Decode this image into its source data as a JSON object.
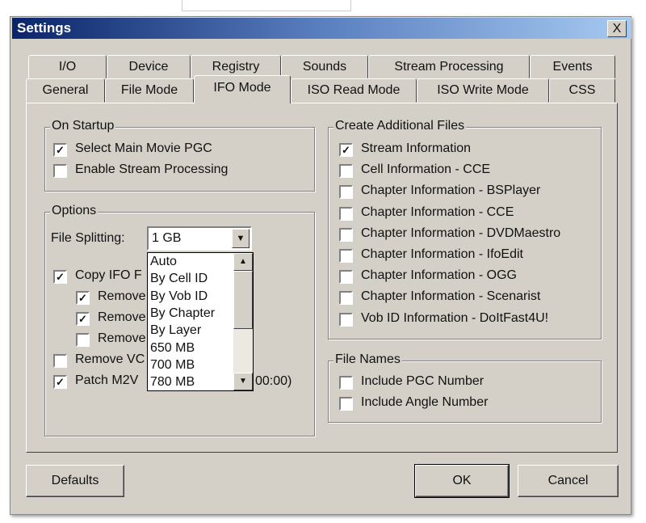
{
  "window": {
    "title": "Settings",
    "close": "X"
  },
  "tabs_row1": [
    "I/O",
    "Device",
    "Registry",
    "Sounds",
    "Stream Processing",
    "Events"
  ],
  "tabs_row2": [
    "General",
    "File Mode",
    "IFO Mode",
    "ISO Read Mode",
    "ISO Write Mode",
    "CSS"
  ],
  "selected_tab": "IFO Mode",
  "on_startup": {
    "legend": "On Startup",
    "items": [
      {
        "label": "Select Main Movie PGC",
        "checked": true
      },
      {
        "label": "Enable Stream Processing",
        "checked": false
      }
    ]
  },
  "options": {
    "legend": "Options",
    "file_splitting_label": "File Splitting:",
    "file_splitting_value": "1 GB",
    "dropdown_options": [
      "Auto",
      "By Cell ID",
      "By Vob ID",
      "By Chapter",
      "By Layer",
      "650 MB",
      "700 MB",
      "780 MB"
    ],
    "items": [
      {
        "label": "Copy IFO F",
        "checked": true
      },
      {
        "label": "Remove",
        "checked": true
      },
      {
        "label": "Remove",
        "checked": true
      },
      {
        "label": "Remove",
        "checked": false
      },
      {
        "label": "Remove VC",
        "checked": false
      },
      {
        "label": "Patch M2V",
        "checked": true
      }
    ],
    "patch_tail": "00:00)"
  },
  "create_files": {
    "legend": "Create Additional Files",
    "items": [
      {
        "label": "Stream Information",
        "checked": true
      },
      {
        "label": "Cell Information - CCE",
        "checked": false
      },
      {
        "label": "Chapter Information - BSPlayer",
        "checked": false
      },
      {
        "label": "Chapter Information - CCE",
        "checked": false
      },
      {
        "label": "Chapter Information - DVDMaestro",
        "checked": false
      },
      {
        "label": "Chapter Information - IfoEdit",
        "checked": false
      },
      {
        "label": "Chapter Information - OGG",
        "checked": false
      },
      {
        "label": "Chapter Information - Scenarist",
        "checked": false
      },
      {
        "label": "Vob ID Information - DoItFast4U!",
        "checked": false
      }
    ]
  },
  "file_names": {
    "legend": "File Names",
    "items": [
      {
        "label": "Include PGC Number",
        "checked": false
      },
      {
        "label": "Include Angle Number",
        "checked": false
      }
    ]
  },
  "buttons": {
    "defaults": "Defaults",
    "ok": "OK",
    "cancel": "Cancel"
  }
}
